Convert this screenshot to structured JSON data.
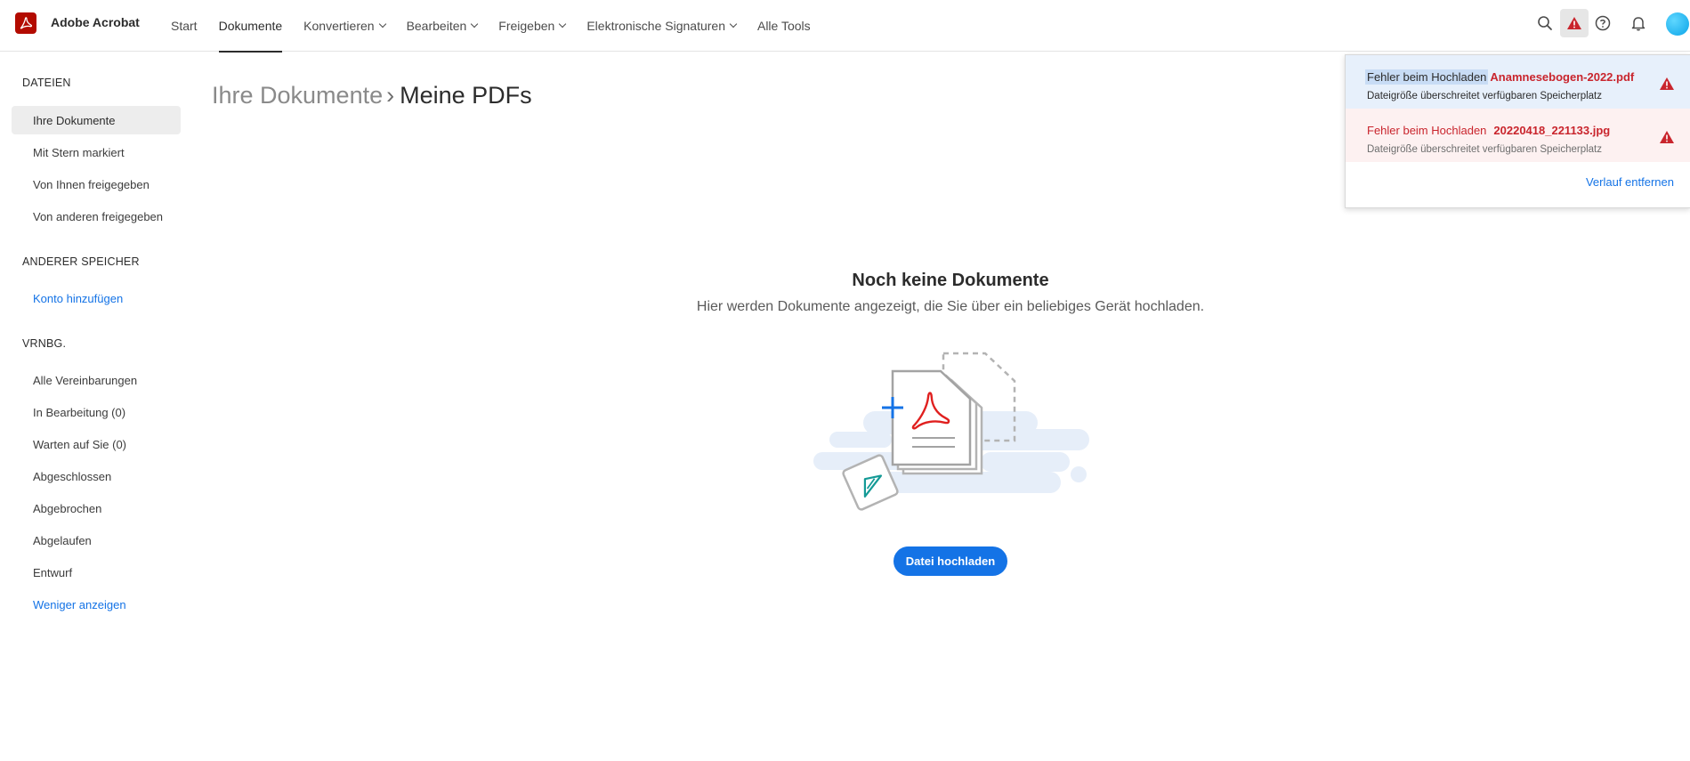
{
  "app": {
    "title": "Adobe Acrobat",
    "brand_color": "#b30b00"
  },
  "nav": {
    "items": [
      {
        "label": "Start",
        "dropdown": false,
        "active": false
      },
      {
        "label": "Dokumente",
        "dropdown": false,
        "active": true
      },
      {
        "label": "Konvertieren",
        "dropdown": true,
        "active": false
      },
      {
        "label": "Bearbeiten",
        "dropdown": true,
        "active": false
      },
      {
        "label": "Freigeben",
        "dropdown": true,
        "active": false
      },
      {
        "label": "Elektronische Signaturen",
        "dropdown": true,
        "active": false
      },
      {
        "label": "Alle Tools",
        "dropdown": false,
        "active": false
      }
    ]
  },
  "header_icons": [
    "search-icon",
    "warning-icon",
    "help-icon",
    "bell-icon",
    "avatar"
  ],
  "sidebar": {
    "files": {
      "heading": "DATEIEN",
      "items": [
        {
          "label": "Ihre Dokumente",
          "selected": true
        },
        {
          "label": "Mit Stern markiert"
        },
        {
          "label": "Von Ihnen freigegeben"
        },
        {
          "label": "Von anderen freigegeben"
        }
      ]
    },
    "storage": {
      "heading": "ANDERER SPEICHER",
      "add_account": "Konto hinzufügen"
    },
    "agreements": {
      "heading": "VRNBG.",
      "items": [
        {
          "label": "Alle Vereinbarungen"
        },
        {
          "label": "In Bearbeitung (0)"
        },
        {
          "label": "Warten auf Sie (0)"
        },
        {
          "label": "Abgeschlossen"
        },
        {
          "label": "Abgebrochen"
        },
        {
          "label": "Abgelaufen"
        },
        {
          "label": "Entwurf"
        }
      ],
      "show_less": "Weniger anzeigen"
    }
  },
  "main": {
    "breadcrumb": {
      "parent": "Ihre Dokumente",
      "separator": "›",
      "current": "Meine PDFs"
    },
    "empty_state": {
      "title": "Noch keine Dokumente",
      "subtitle": "Hier werden Dokumente angezeigt, die Sie über ein beliebiges Gerät hochladen.",
      "upload_button": "Datei hochladen"
    }
  },
  "notifications": {
    "items": [
      {
        "status": "Fehler beim Hochladen",
        "file": "Anamnesebogen-2022.pdf",
        "message": "Dateigröße überschreitet verfügbaren Speicherplatz",
        "icon": "warning-icon"
      },
      {
        "status": "Fehler beim Hochladen",
        "file": "20220418_221133.jpg",
        "message": "Dateigröße überschreitet verfügbaren Speicherplatz",
        "icon": "warning-icon"
      }
    ],
    "clear_history": "Verlauf entfernen"
  },
  "colors": {
    "accent": "#1473e6",
    "error": "#c9252d"
  }
}
